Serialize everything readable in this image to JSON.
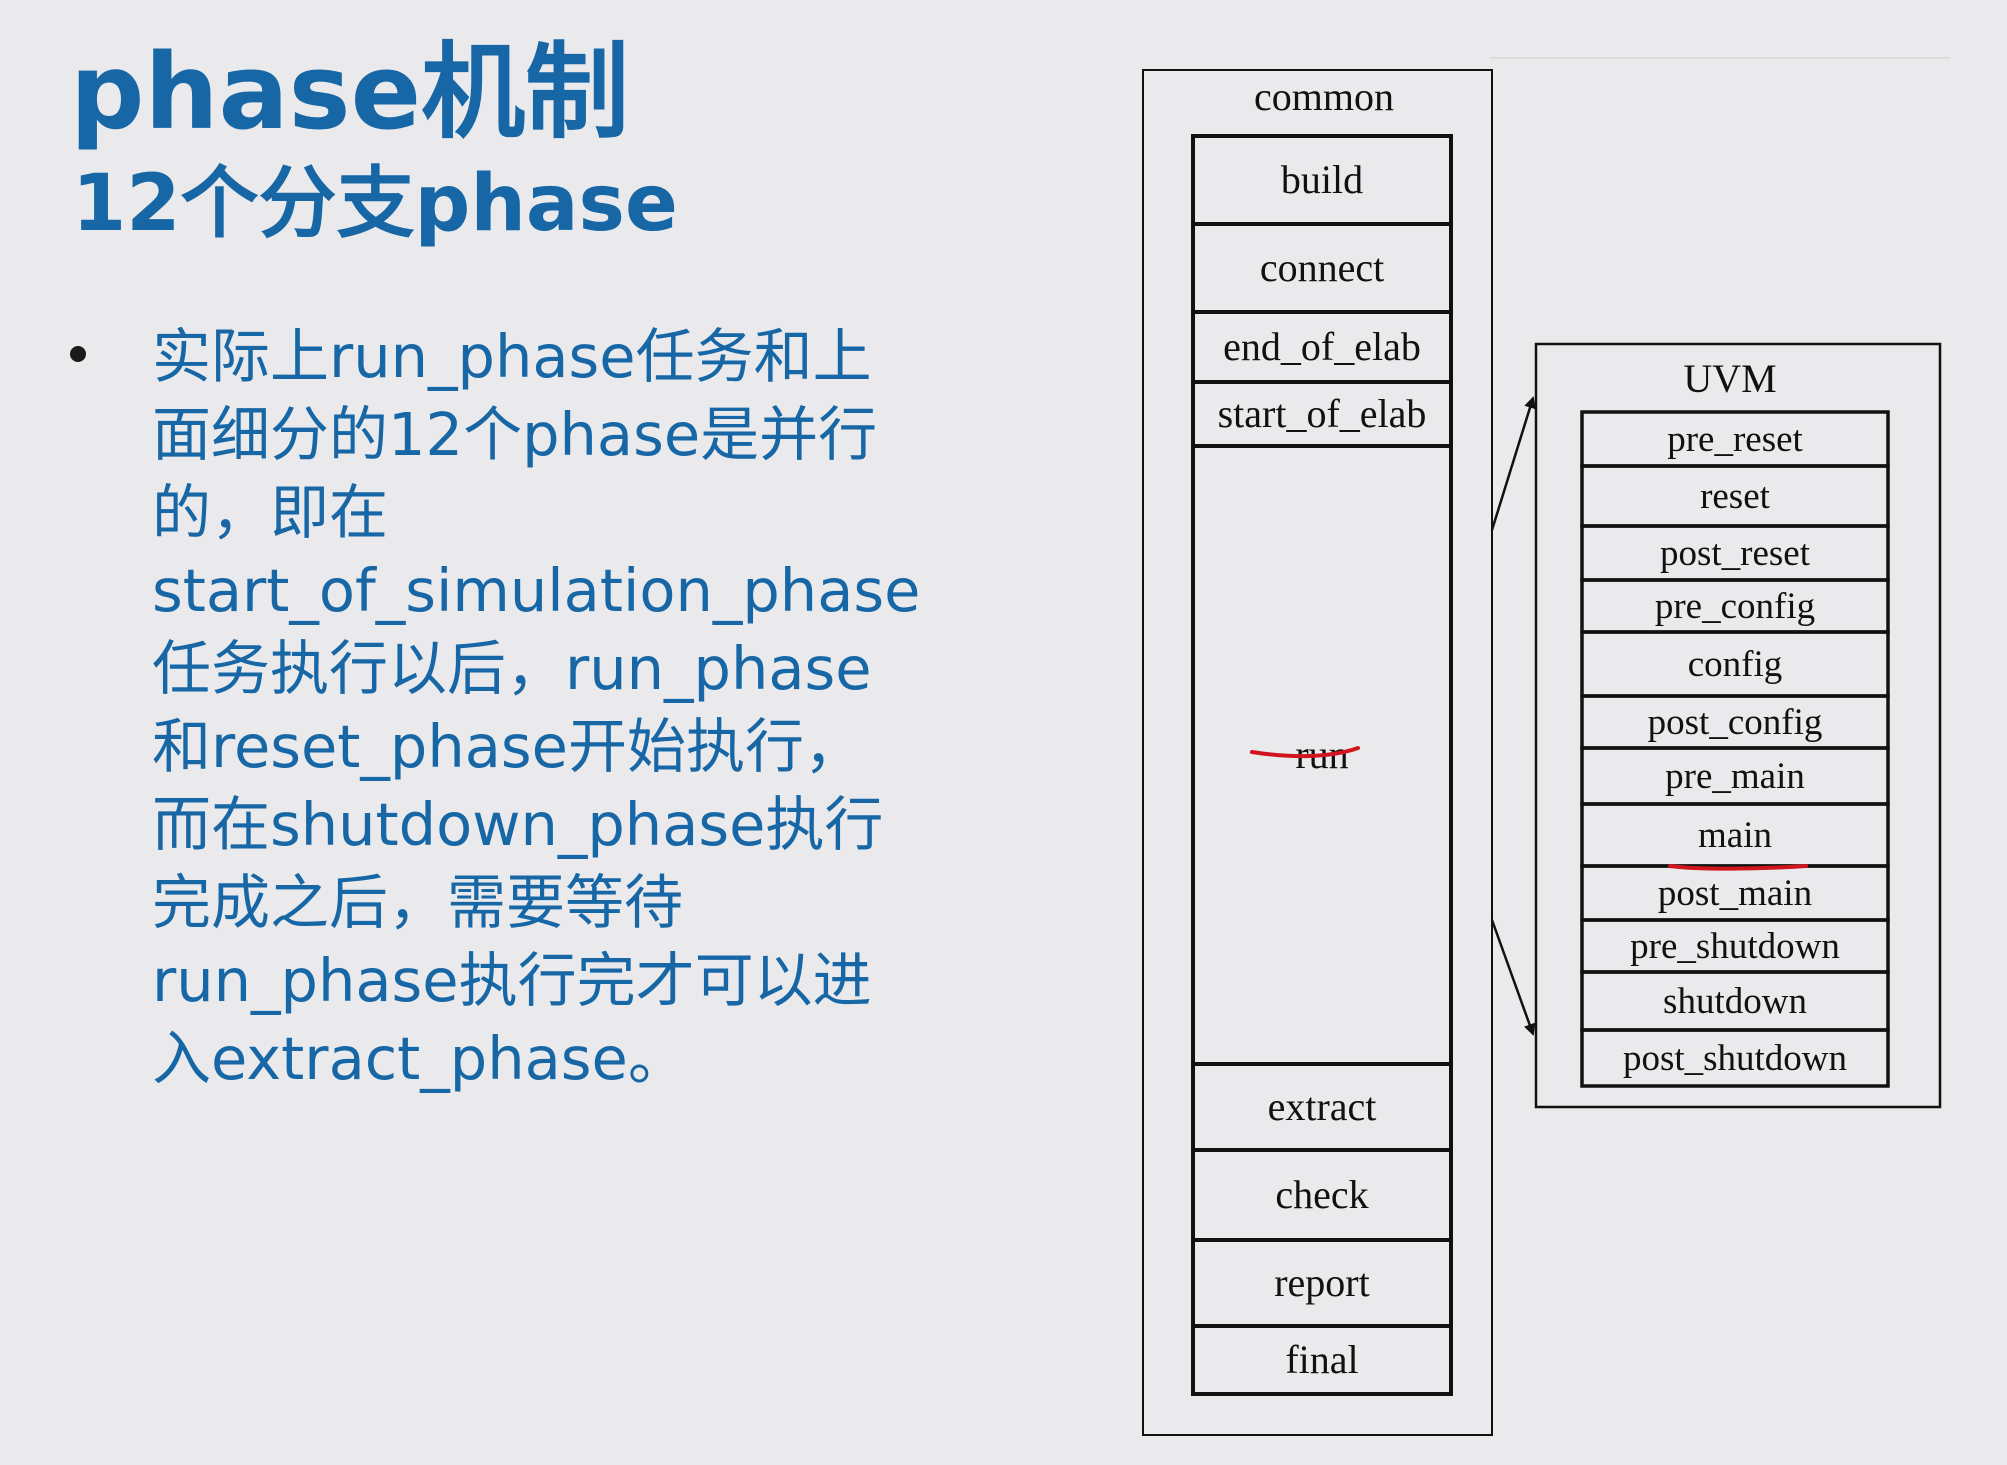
{
  "slide": {
    "title": "phase机制",
    "subtitle": "12个分支phase",
    "bullet": [
      "实际上run_phase任务和上",
      "面细分的12个phase是并行",
      "的，即在",
      "start_of_simulation_phase",
      "任务执行以后，run_phase",
      "和reset_phase开始执行，",
      "而在shutdown_phase执行",
      "完成之后，需要等待",
      "run_phase执行完才可以进",
      "入extract_phase。"
    ]
  },
  "diagram": {
    "common": {
      "label": "common",
      "phases": [
        "build",
        "connect",
        "end_of_elab",
        "start_of_elab",
        "run",
        "extract",
        "check",
        "report",
        "final"
      ]
    },
    "uvm": {
      "label": "UVM",
      "phases": [
        "pre_reset",
        "reset",
        "post_reset",
        "pre_config",
        "config",
        "post_config",
        "pre_main",
        "main",
        "post_main",
        "pre_shutdown",
        "shutdown",
        "post_shutdown"
      ]
    },
    "annotation_color": "#d0151f"
  }
}
